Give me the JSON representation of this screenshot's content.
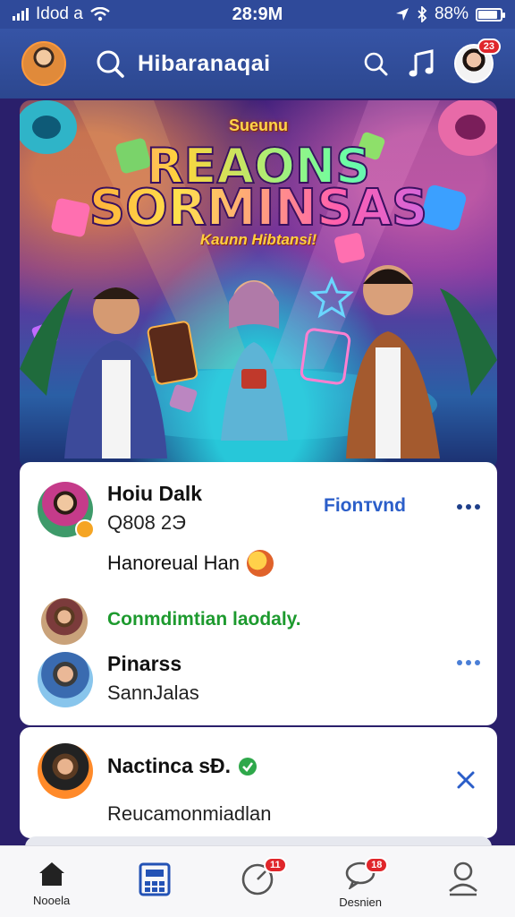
{
  "status_bar": {
    "carrier": "Idod a",
    "time": "28:9M",
    "battery": "88%",
    "battery_level": 0.88
  },
  "header": {
    "title": "Hibaranaqai",
    "profile_badge": "23"
  },
  "banner": {
    "tag": "Sueunu",
    "title_line1": "REAONS",
    "title_line2": "SORMINSAS",
    "subtitle": "Kaunn Hibtansi!"
  },
  "posts": {
    "main": {
      "author": "Hoiu Dalk",
      "handle": "Q808 2Э",
      "action": "Fionтvnd",
      "text": "Hanoreual Han"
    },
    "comment_line": "Conmdimtian laodaly.",
    "second": {
      "author": "Pinarss",
      "subtitle": "SannJalas"
    },
    "third": {
      "author": "Nactinca sĐ.",
      "text": "Reucamonmiadlan"
    }
  },
  "bottom_nav": {
    "items": [
      {
        "label": "Nooela",
        "icon": "home-icon"
      },
      {
        "label": "",
        "icon": "grid-calendar-icon"
      },
      {
        "label": "",
        "icon": "timer-icon",
        "badge": "11"
      },
      {
        "label": "Desnien",
        "icon": "chat-icon",
        "badge": "18"
      },
      {
        "label": "",
        "icon": "profile-icon"
      }
    ]
  },
  "colors": {
    "header_bg": "#3654a6",
    "accent_blue": "#2b5ec9",
    "badge_red": "#e0262b",
    "verified_green": "#1d9a2e"
  }
}
